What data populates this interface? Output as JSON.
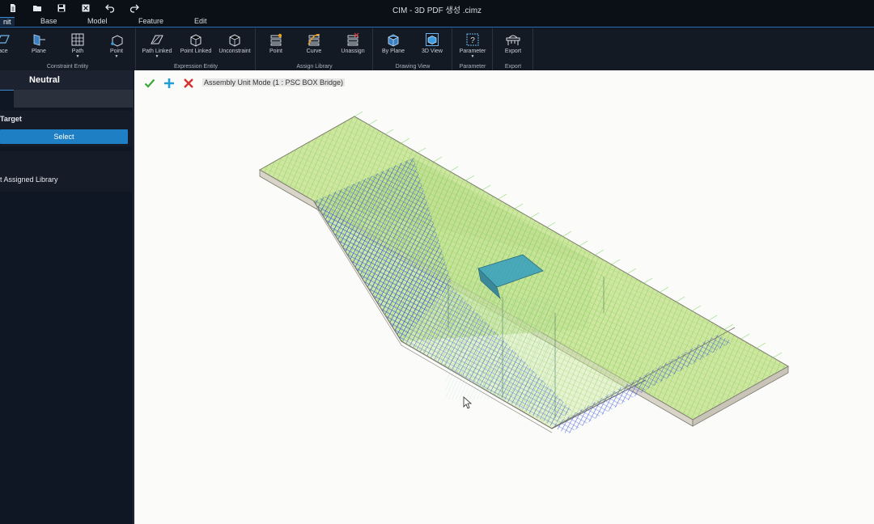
{
  "window": {
    "title": "CIM - 3D PDF 생성 .cimz"
  },
  "quick_access": [
    {
      "icon": "new-file-icon"
    },
    {
      "icon": "open-folder-icon"
    },
    {
      "icon": "save-icon"
    },
    {
      "icon": "close-file-icon"
    },
    {
      "icon": "undo-icon"
    },
    {
      "icon": "redo-icon"
    }
  ],
  "menu": {
    "tabs": [
      "nit",
      "Base",
      "Model",
      "Feature",
      "Edit"
    ],
    "active_index": 0
  },
  "ribbon": {
    "groups": {
      "constraint_entity": {
        "label": "Constraint Entity",
        "buttons": [
          "ace",
          "Plane",
          "Path",
          "Point"
        ]
      },
      "expression_entity": {
        "label": "Expression Entity",
        "buttons": [
          "Path Linked",
          "Point Linked",
          "Unconstraint"
        ]
      },
      "assign_library": {
        "label": "Assign Library",
        "buttons": [
          "Point",
          "Curve",
          "Unassign"
        ]
      },
      "drawing_view": {
        "label": "Drawing View",
        "buttons": [
          "By Plane",
          "3D View"
        ]
      },
      "parameter": {
        "label": "Parameter",
        "buttons": [
          "Parameter"
        ]
      },
      "export": {
        "label": "Export",
        "buttons": [
          "Export"
        ]
      }
    }
  },
  "side_panel": {
    "title": "Neutral",
    "target_label": "Target",
    "select_button": "Select",
    "library_label": "t Assigned Library"
  },
  "viewport": {
    "mode_label": "Assembly Unit Mode (1 : PSC BOX Bridge)",
    "colors": {
      "accept": "#3aa83a",
      "add": "#1e9fd6",
      "cancel": "#d83030",
      "deck_fill": "#cfe6a0",
      "mesh_green": "#5fcf3a",
      "mesh_blue": "#1a2fd0",
      "concrete": "#d8d4c8"
    }
  }
}
